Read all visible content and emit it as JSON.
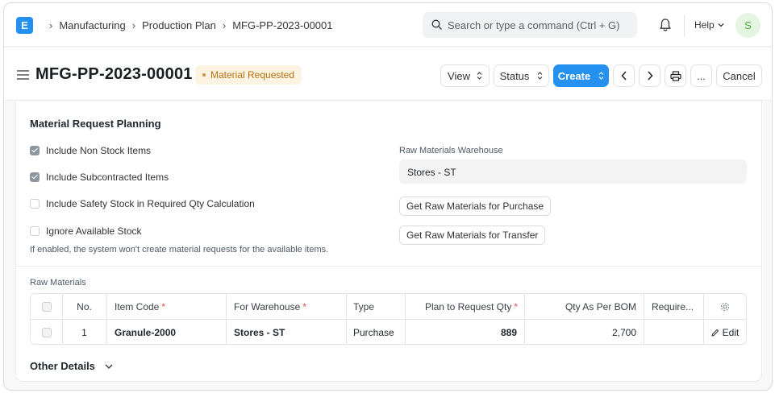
{
  "navbar": {
    "logo_letter": "E",
    "breadcrumbs": [
      "Manufacturing",
      "Production Plan",
      "MFG-PP-2023-00001"
    ],
    "search_placeholder": "Search or type a command (Ctrl + G)",
    "help_label": "Help",
    "avatar_initial": "S"
  },
  "page": {
    "title": "MFG-PP-2023-00001",
    "status": "Material Requested",
    "actions": {
      "view": "View",
      "status": "Status",
      "create": "Create",
      "more": "...",
      "cancel": "Cancel"
    }
  },
  "section": {
    "title": "Material Request Planning",
    "checkboxes": [
      {
        "label": "Include Non Stock Items",
        "checked": true
      },
      {
        "label": "Include Subcontracted Items",
        "checked": true
      },
      {
        "label": "Include Safety Stock in Required Qty Calculation",
        "checked": false
      },
      {
        "label": "Ignore Available Stock",
        "checked": false
      }
    ],
    "ignore_stock_help": "If enabled, the system won't create material requests for the available items.",
    "warehouse_label": "Raw Materials Warehouse",
    "warehouse_value": "Stores - ST",
    "btn_purchase": "Get Raw Materials for Purchase",
    "btn_transfer": "Get Raw Materials for Transfer"
  },
  "raw_materials": {
    "label": "Raw Materials",
    "columns": [
      "No.",
      "Item Code",
      "For Warehouse",
      "Type",
      "Plan to Request Qty",
      "Qty As Per BOM",
      "Require..."
    ],
    "rows": [
      {
        "no": "1",
        "item_code": "Granule-2000",
        "warehouse": "Stores - ST",
        "type": "Purchase",
        "plan_qty": "889",
        "bom_qty": "2,700",
        "required": "",
        "edit": "Edit"
      }
    ]
  },
  "other_details": "Other Details",
  "colors": {
    "primary": "#2490ef",
    "badge_bg": "#fdf3e3",
    "badge_text": "#b3700f",
    "required": "#e24c4c"
  }
}
